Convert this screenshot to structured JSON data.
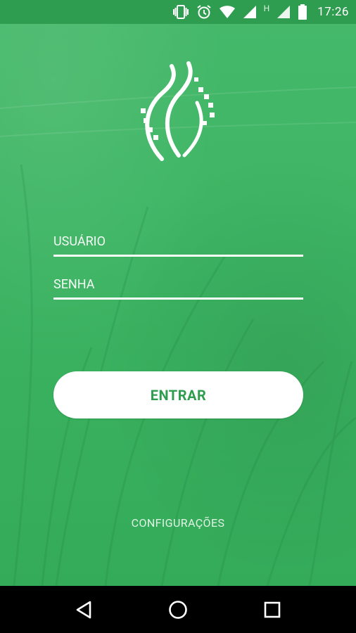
{
  "status_bar": {
    "time": "17:26",
    "icons": [
      "vibrate-icon",
      "alarm-icon",
      "wifi-icon",
      "signal-icon",
      "network-h-icon",
      "signal-icon",
      "battery-icon"
    ],
    "network_label": "H"
  },
  "login": {
    "username_placeholder": "USUÁRIO",
    "password_placeholder": "SENHA",
    "submit_label": "ENTRAR",
    "settings_link": "CONFIGURAÇÕES"
  },
  "colors": {
    "primary_green": "#2e9d4f",
    "background_green": "#3fb665",
    "white": "#ffffff"
  },
  "nav_bar": {
    "buttons": [
      "back-icon",
      "home-icon",
      "recents-icon"
    ]
  }
}
